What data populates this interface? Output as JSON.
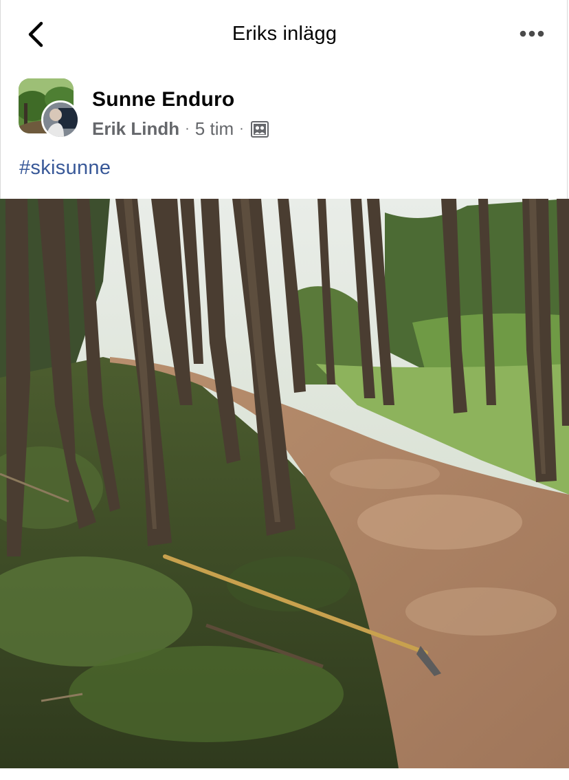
{
  "nav": {
    "title": "Eriks inlägg",
    "back_icon": "chevron-left-icon",
    "more_icon": "ellipsis-icon"
  },
  "post": {
    "group_name": "Sunne Enduro",
    "author": "Erik Lindh",
    "separator": "·",
    "time": "5 tim",
    "privacy_icon": "group-members-icon",
    "hashtag": "#skisunne"
  },
  "colors": {
    "text_primary": "#050505",
    "text_secondary": "#65676b",
    "link": "#385898",
    "background": "#ffffff"
  }
}
